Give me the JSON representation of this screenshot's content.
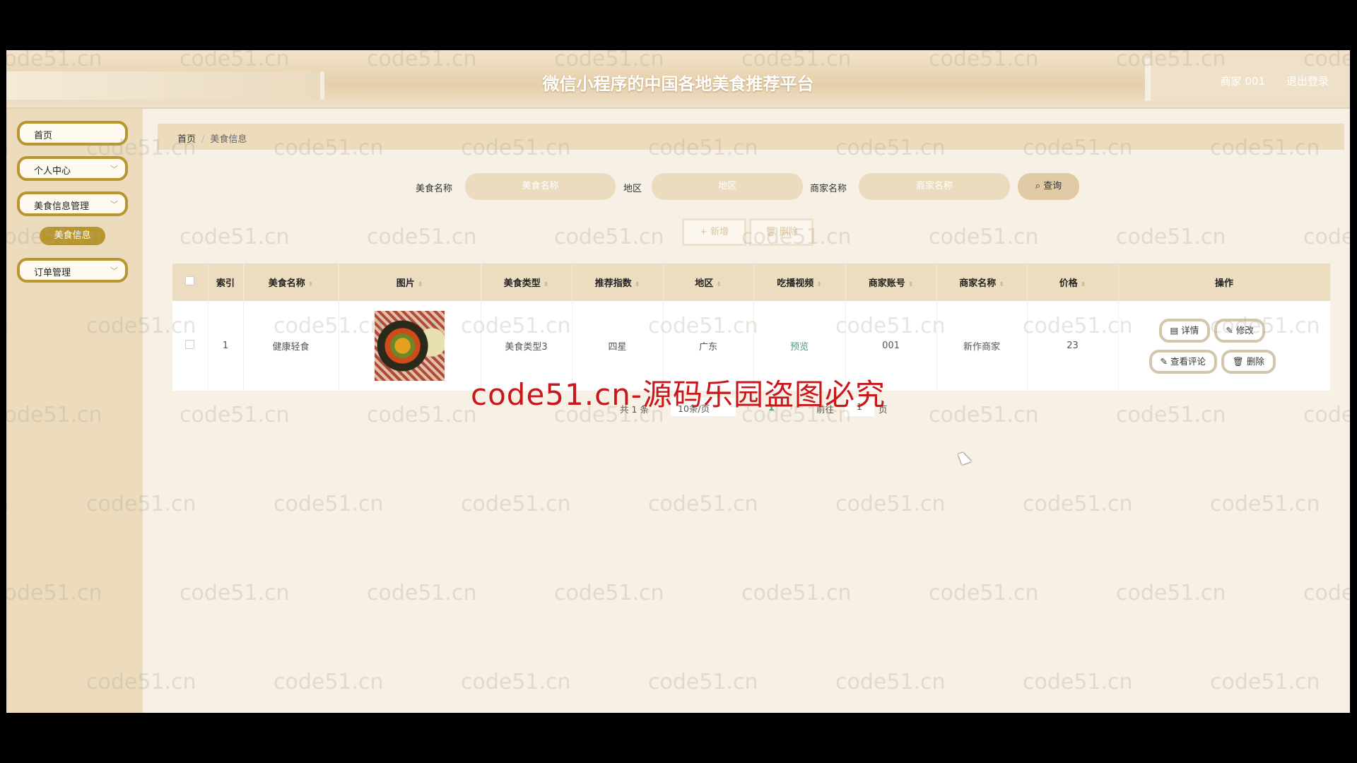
{
  "header": {
    "title": "微信小程序的中国各地美食推荐平台",
    "user": "商家 001",
    "logout": "退出登录"
  },
  "sidebar": {
    "items": [
      {
        "label": "首页"
      },
      {
        "label": "个人中心"
      },
      {
        "label": "美食信息管理"
      },
      {
        "label": "订单管理"
      }
    ],
    "sub_item": "美食信息"
  },
  "breadcrumb": {
    "home": "首页",
    "current": "美食信息"
  },
  "search": {
    "name_label": "美食名称",
    "name_placeholder": "美食名称",
    "region_label": "地区",
    "region_placeholder": "地区",
    "merchant_label": "商家名称",
    "merchant_placeholder": "商家名称",
    "query": "查询"
  },
  "toolbar": {
    "add": "+ 新增",
    "delete": "删除"
  },
  "table": {
    "headers": [
      "索引",
      "美食名称",
      "图片",
      "美食类型",
      "推荐指数",
      "地区",
      "吃播视频",
      "商家账号",
      "商家名称",
      "价格",
      "操作"
    ],
    "rows": [
      {
        "index": "1",
        "name": "健康轻食",
        "type": "美食类型3",
        "rating": "四星",
        "region": "广东",
        "video": "预览",
        "account": "001",
        "merchant": "新作商家",
        "price": "23"
      }
    ],
    "actions": {
      "detail": "详情",
      "edit": "修改",
      "comments": "查看评论",
      "delete": "删除"
    }
  },
  "pagination": {
    "total": "共 1 条",
    "page_size": "10条/页",
    "current_page": "1",
    "goto_label": "前往",
    "goto_value": "1",
    "page_suffix": "页"
  },
  "watermark": {
    "text": "code51.cn",
    "red_text": "code51.cn-源码乐园盗图必究"
  },
  "colors": {
    "accent": "#b8962e",
    "table_header": "#ecdcc0",
    "sidebar": "#ecdcbd",
    "video_link": "#3aa57a"
  }
}
